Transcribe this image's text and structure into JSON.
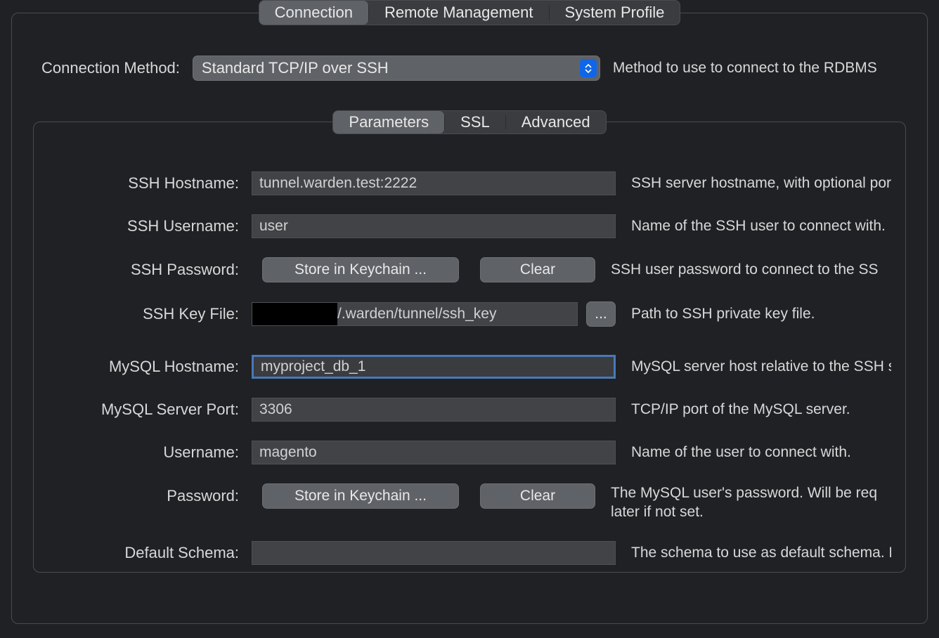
{
  "topTabs": {
    "items": [
      "Connection",
      "Remote Management",
      "System Profile"
    ],
    "activeIndex": 0
  },
  "connectionMethod": {
    "label": "Connection Method:",
    "value": "Standard TCP/IP over SSH",
    "hint": "Method to use to connect to the RDBMS"
  },
  "innerTabs": {
    "items": [
      "Parameters",
      "SSL",
      "Advanced"
    ],
    "activeIndex": 0
  },
  "fields": {
    "sshHostname": {
      "label": "SSH Hostname:",
      "value": "tunnel.warden.test:2222",
      "hint": "SSH server hostname, with  optional por"
    },
    "sshUsername": {
      "label": "SSH Username:",
      "value": "user",
      "hint": "Name of the SSH user to connect with."
    },
    "sshPassword": {
      "label": "SSH Password:",
      "storeBtn": "Store in Keychain ...",
      "clearBtn": "Clear",
      "hint": "SSH user password to connect to the SS"
    },
    "sshKeyFile": {
      "label": "SSH Key File:",
      "value": "/.warden/tunnel/ssh_key",
      "browseBtn": "...",
      "hint": "Path to SSH private key file."
    },
    "mysqlHostname": {
      "label": "MySQL Hostname:",
      "value": "myproject_db_1",
      "hint": "MySQL server host relative to the SSH s"
    },
    "mysqlPort": {
      "label": "MySQL Server Port:",
      "value": "3306",
      "hint": "TCP/IP port of the MySQL server."
    },
    "username": {
      "label": "Username:",
      "value": "magento",
      "hint": "Name of the user to connect with."
    },
    "password": {
      "label": "Password:",
      "storeBtn": "Store in Keychain ...",
      "clearBtn": "Clear",
      "hint": "The MySQL user's password. Will be req later if not set."
    },
    "defaultSchema": {
      "label": "Default Schema:",
      "value": "",
      "hint": "The schema to use as default schema. L"
    }
  }
}
